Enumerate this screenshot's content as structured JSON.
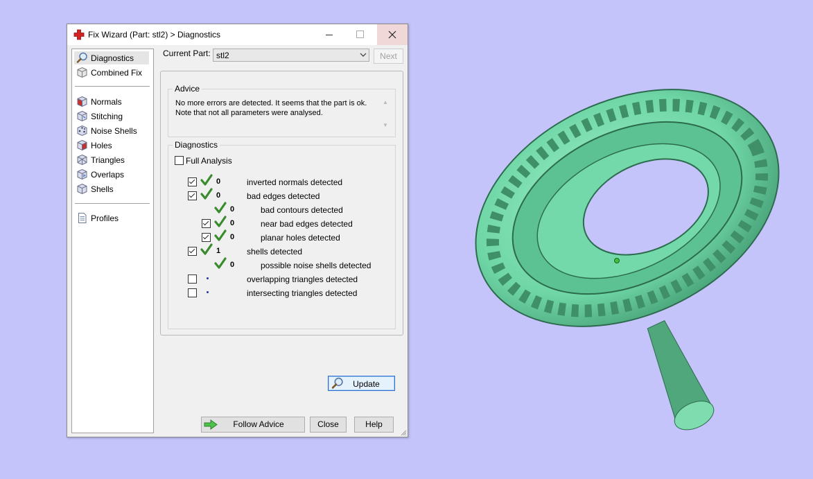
{
  "window": {
    "title": "Fix Wizard (Part: stl2) > Diagnostics"
  },
  "nav": {
    "top_items": [
      {
        "label": "Diagnostics",
        "icon": "magnifier-icon",
        "selected": true
      },
      {
        "label": "Combined Fix",
        "icon": "cube-icon"
      }
    ],
    "mid_items": [
      {
        "label": "Normals",
        "icon": "normals-cube-icon"
      },
      {
        "label": "Stitching",
        "icon": "stitching-cube-icon"
      },
      {
        "label": "Noise Shells",
        "icon": "noise-shells-cube-icon"
      },
      {
        "label": "Holes",
        "icon": "holes-cube-icon"
      },
      {
        "label": "Triangles",
        "icon": "triangles-cube-icon"
      },
      {
        "label": "Overlaps",
        "icon": "overlaps-cube-icon"
      },
      {
        "label": "Shells",
        "icon": "shells-cube-icon"
      }
    ],
    "bottom_items": [
      {
        "label": "Profiles",
        "icon": "document-icon"
      }
    ]
  },
  "current_part": {
    "label": "Current Part:",
    "value": "stl2",
    "next_label": "Next"
  },
  "advice": {
    "title": "Advice",
    "text": "No more errors are detected. It seems that the part is ok. Note that not all parameters were analysed."
  },
  "diagnostics": {
    "title": "Diagnostics",
    "full_analysis_label": "Full Analysis",
    "full_analysis_checked": false,
    "rows": [
      {
        "checkbox": true,
        "checked": true,
        "status": "check",
        "count": "0",
        "label": "inverted normals detected",
        "indent": 0
      },
      {
        "checkbox": true,
        "checked": true,
        "status": "check",
        "count": "0",
        "label": "bad edges detected",
        "indent": 0
      },
      {
        "checkbox": false,
        "checked": false,
        "status": "check",
        "count": "0",
        "label": "bad contours detected",
        "indent": 1
      },
      {
        "checkbox": true,
        "checked": true,
        "status": "check",
        "count": "0",
        "label": "near bad edges detected",
        "indent": 1
      },
      {
        "checkbox": true,
        "checked": true,
        "status": "check",
        "count": "0",
        "label": "planar holes detected",
        "indent": 1
      },
      {
        "checkbox": true,
        "checked": true,
        "status": "check",
        "count": "1",
        "label": "shells detected",
        "indent": 0
      },
      {
        "checkbox": false,
        "checked": false,
        "status": "check",
        "count": "0",
        "label": "possible noise shells detected",
        "indent": 1
      },
      {
        "checkbox": true,
        "checked": false,
        "status": "dot",
        "count": "",
        "label": "overlapping triangles detected",
        "indent": 0
      },
      {
        "checkbox": true,
        "checked": false,
        "status": "dot",
        "count": "",
        "label": "intersecting triangles detected",
        "indent": 0
      }
    ],
    "update_label": "Update"
  },
  "buttons": {
    "follow_advice": "Follow Advice",
    "close": "Close",
    "help": "Help"
  },
  "colors": {
    "background": "#c4c4fb",
    "model": "#6fd6a6",
    "check": "#3a8a2e"
  }
}
